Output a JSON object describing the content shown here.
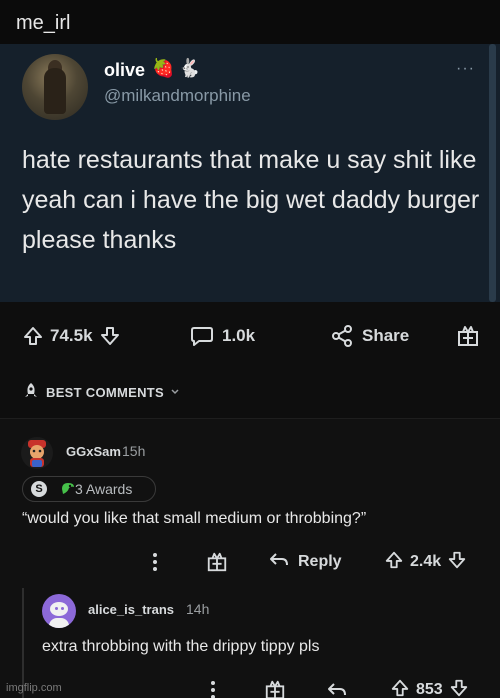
{
  "top_bar": {
    "title": "me_irl"
  },
  "tweet": {
    "display_name": "olive",
    "emojis": [
      "🍓",
      "🐇"
    ],
    "handle": "@milkandmorphine",
    "more": "···",
    "text": "hate restaurants that make u say shit like yeah can i have the big wet daddy burger please thanks"
  },
  "post_actions": {
    "upvotes": "74.5k",
    "comments": "1.0k",
    "share": "Share"
  },
  "comments_section": {
    "sort_label": "BEST COMMENTS"
  },
  "comment": {
    "username": "GGxSam",
    "age": "15h",
    "awards_label": "3 Awards",
    "award_badge": "S",
    "text": "“would you like that small medium or throbbing?”",
    "reply_label": "Reply",
    "votes": "2.4k"
  },
  "reply": {
    "username": "alice_is_trans",
    "age": "14h",
    "text": "extra throbbing with the drippy tippy pls",
    "votes": "853"
  },
  "watermark": "imgflip.com",
  "colors": {
    "tweet_bg": "#15202b",
    "page_bg": "#0e0e0e",
    "comment_bg": "#111111",
    "reply_avatar": "#8c69d8"
  },
  "icons": [
    "upvote-icon",
    "downvote-icon",
    "comment-icon",
    "share-icon",
    "award-icon",
    "rocket-icon",
    "chevron-down-icon",
    "more-vertical-icon",
    "reply-icon"
  ]
}
